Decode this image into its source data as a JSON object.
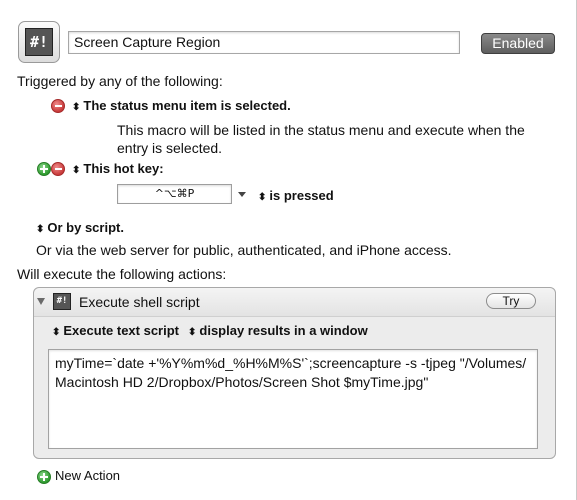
{
  "macro": {
    "icon_label": "#!",
    "name": "Screen Capture Region",
    "enabled_label": "Enabled"
  },
  "triggers": {
    "heading": "Triggered by any of the following:",
    "status_menu": {
      "label": "The status menu item is selected.",
      "description_line1": "This macro will be listed in the status menu and execute when the",
      "description_line2": "entry is selected."
    },
    "hotkey": {
      "label": "This hot key:",
      "keys": "^⌥⌘P",
      "condition": "is pressed"
    },
    "by_script": "Or by script.",
    "web_server": "Or via the web server for public, authenticated, and iPhone access."
  },
  "actions": {
    "heading": "Will execute the following actions:",
    "items": [
      {
        "icon_label": "#!",
        "title": "Execute shell script",
        "try_label": "Try",
        "mode": "Execute text script",
        "output": "display results in a window",
        "script_text": "myTime=`date +'%Y%m%d_%H%M%S'`;screencapture -s -tjpeg \"/Volumes/Macintosh HD 2/Dropbox/Photos/Screen Shot $myTime.jpg\""
      }
    ],
    "new_action_label": "New Action"
  },
  "icons": {
    "remove": "minus-circle-icon",
    "add": "plus-circle-icon",
    "updown": "up-down-arrows-icon"
  },
  "colors": {
    "remove_red": "#c83a3a",
    "add_green": "#2e9a2e",
    "enabled_button": "#6e6e6e"
  }
}
